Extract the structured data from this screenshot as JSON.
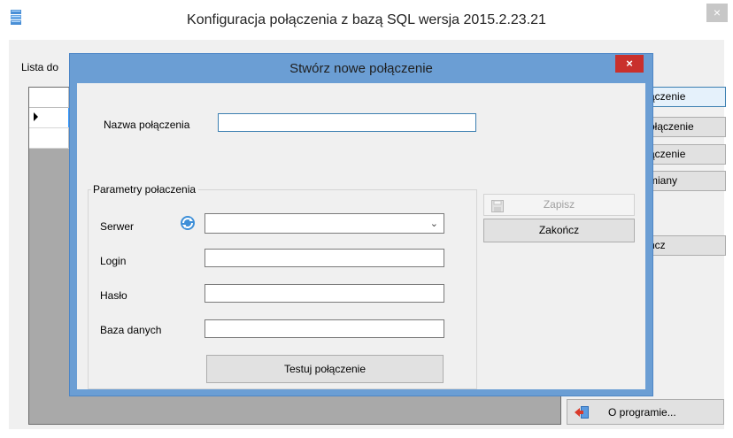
{
  "main_window": {
    "title": "Konfiguracja połączenia z bazą SQL wersja 2015.2.23.21",
    "close_glyph": "×",
    "list_label": "Lista do",
    "side_buttons": [
      "ączenie",
      "ołączenie",
      "ączenie",
      "miany",
      "ńcz"
    ],
    "about_button": "O programie..."
  },
  "dialog": {
    "title": "Stwórz nowe połączenie",
    "close_glyph": "×",
    "connection_name_label": "Nazwa połączenia",
    "connection_name_value": "",
    "params_group_title": "Parametry połaczenia",
    "server_label": "Serwer",
    "server_value": "",
    "login_label": "Login",
    "login_value": "",
    "password_label": "Hasło",
    "password_value": "",
    "database_label": "Baza danych",
    "database_value": "",
    "test_button": "Testuj połączenie",
    "save_button": "Zapisz",
    "close_button": "Zakończ"
  },
  "icons": {
    "app": "database-icon",
    "refresh": "refresh-icon",
    "save": "floppy-disk-icon",
    "exit": "exit-door-icon"
  },
  "colors": {
    "dialog_frame": "#6b9ed4",
    "close_red": "#c9302c",
    "selection_blue": "#3399ff"
  }
}
